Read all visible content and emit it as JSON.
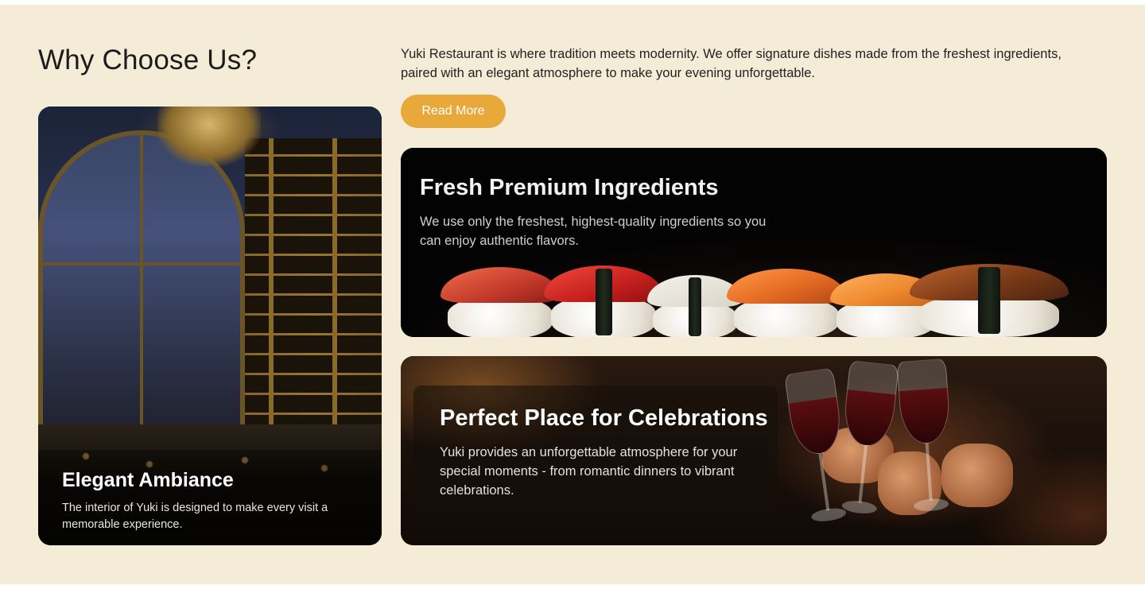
{
  "section": {
    "title": "Why Choose Us?",
    "intro": "Yuki Restaurant is where tradition meets modernity. We offer signature dishes made from the freshest ingredients, paired with an elegant atmosphere to make your evening unforgettable.",
    "read_more_label": "Read More"
  },
  "cards": {
    "ambiance": {
      "title": "Elegant Ambiance",
      "description": "The interior of Yuki is designed to make every visit a memorable experience."
    },
    "ingredients": {
      "title": "Fresh Premium Ingredients",
      "description": "We use only the freshest, highest-quality ingredients so you can enjoy authentic flavors."
    },
    "celebrations": {
      "title": "Perfect Place for Celebrations",
      "description": "Yuki provides an unforgettable atmosphere for your special moments - from romantic dinners to vibrant celebrations."
    }
  },
  "colors": {
    "background": "#f5ecd7",
    "accent": "#e8a93a",
    "heading": "#1b1b1b"
  }
}
